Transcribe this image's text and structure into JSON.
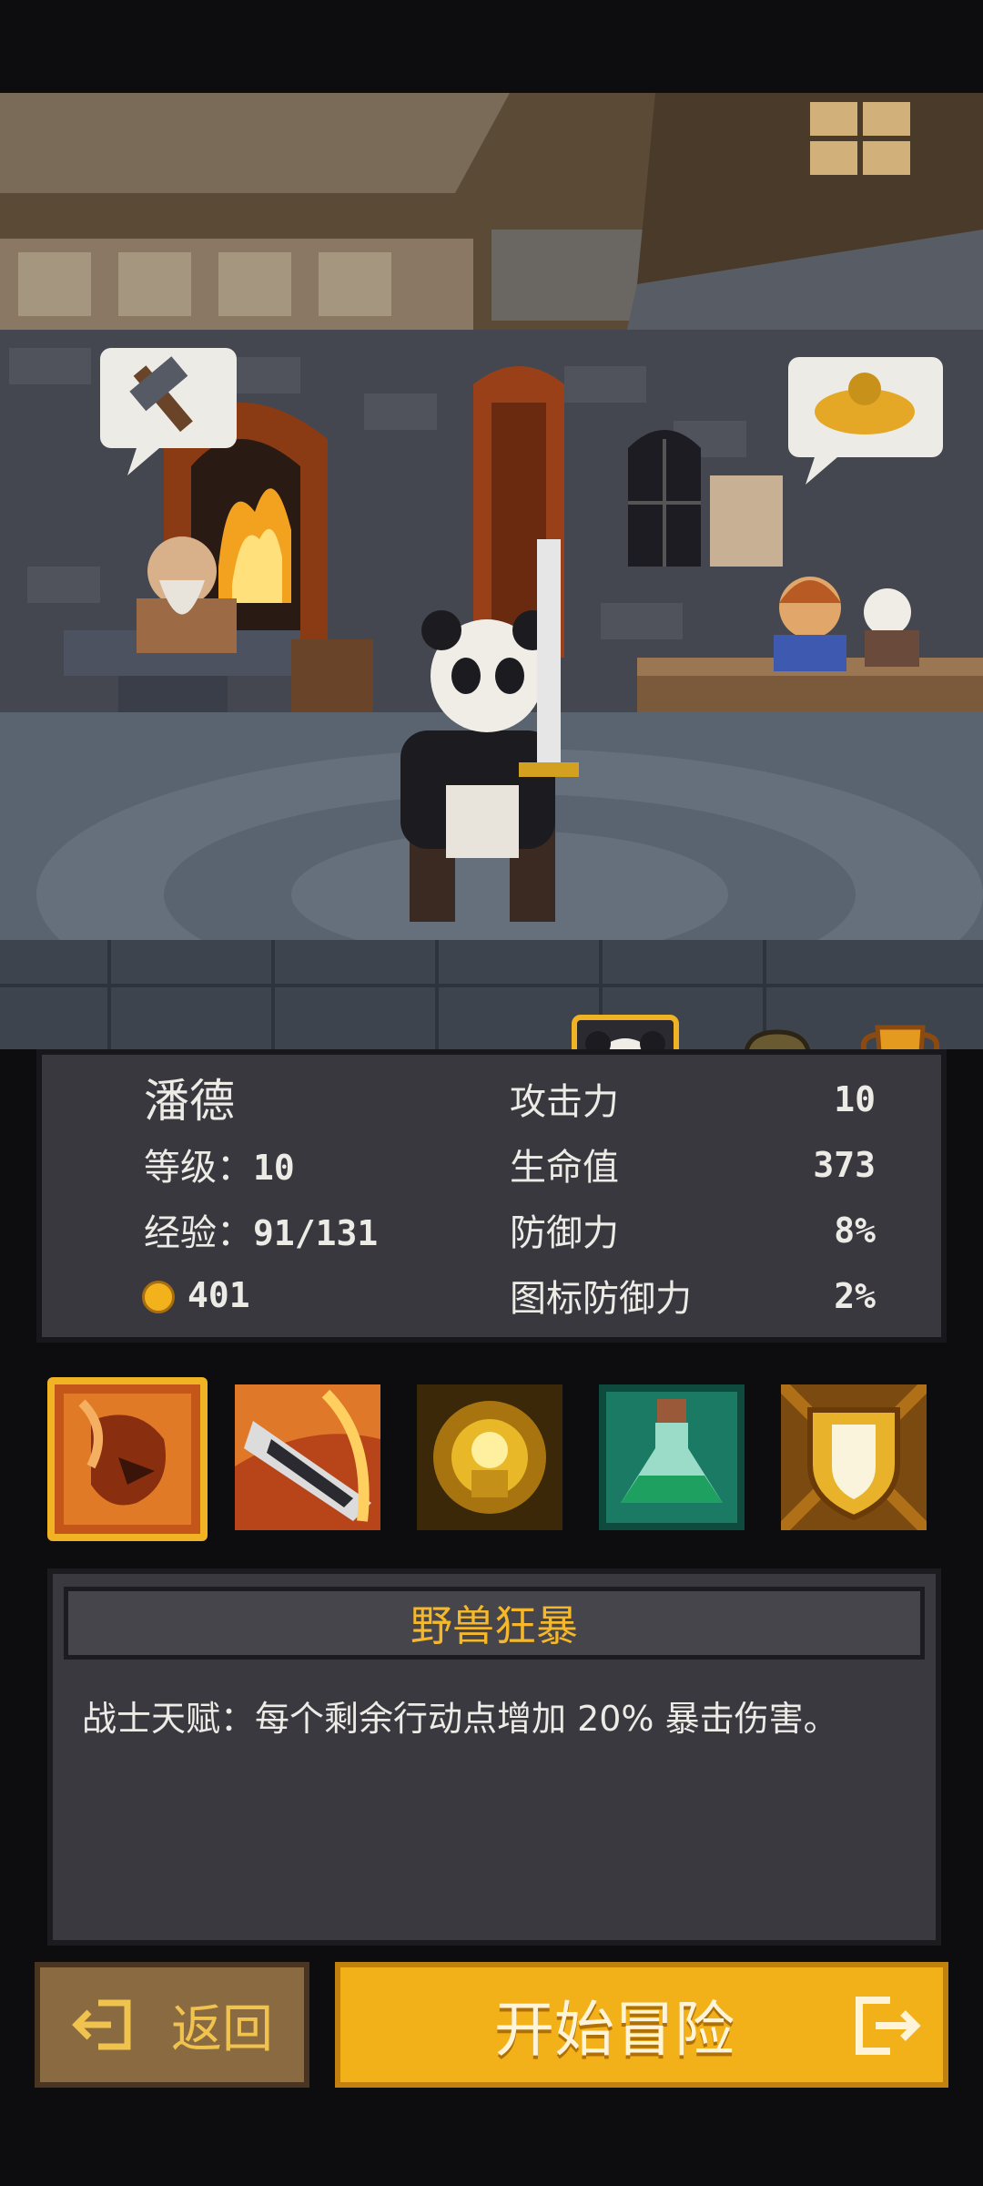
{
  "tabs": [
    {
      "name": "character",
      "icon": "panda-face-icon",
      "active": true
    },
    {
      "name": "inventory",
      "icon": "backpack-icon",
      "active": false
    },
    {
      "name": "achievements",
      "icon": "trophy-icon",
      "active": false
    }
  ],
  "character": {
    "name": "潘德",
    "level_label": "等级：",
    "level": "10",
    "exp_label": "经验：",
    "exp": "91/131",
    "gold": "401"
  },
  "attributes": [
    {
      "label": "攻击力",
      "value": "10"
    },
    {
      "label": "生命值",
      "value": "373"
    },
    {
      "label": "防御力",
      "value": "8%"
    },
    {
      "label": "图标防御力",
      "value": "2%"
    }
  ],
  "skills": [
    {
      "icon": "beast-rage-icon",
      "selected": true
    },
    {
      "icon": "sword-slash-icon",
      "selected": false
    },
    {
      "icon": "golden-burst-icon",
      "selected": false
    },
    {
      "icon": "potion-flask-icon",
      "selected": false
    },
    {
      "icon": "shield-icon",
      "selected": false
    }
  ],
  "skill_detail": {
    "title": "野兽狂暴",
    "description": "战士天赋：每个剩余行动点增加 20% 暴击伤害。"
  },
  "buttons": {
    "back": "返回",
    "start": "开始冒险"
  },
  "colors": {
    "accent": "#f2b118",
    "panel": "#38383e"
  }
}
